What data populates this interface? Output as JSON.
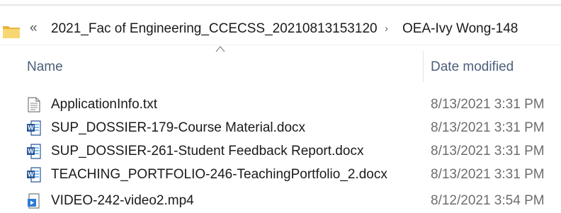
{
  "addressbar": {
    "overflow_label": "«",
    "crumbs": [
      "2021_Fac of Engineering_CCECSS_20210813153120",
      "OEA-Ivy Wong-148"
    ],
    "separator": "›"
  },
  "columns": {
    "name": "Name",
    "date": "Date modified",
    "sort_indicator": "ascending"
  },
  "files": [
    {
      "name": "ApplicationInfo.txt",
      "date": "8/13/2021 3:31 PM",
      "icon": "text-file-icon"
    },
    {
      "name": "SUP_DOSSIER-179-Course Material.docx",
      "date": "8/13/2021 3:31 PM",
      "icon": "word-document-icon"
    },
    {
      "name": "SUP_DOSSIER-261-Student Feedback Report.docx",
      "date": "8/13/2021 3:31 PM",
      "icon": "word-document-icon"
    },
    {
      "name": "TEACHING_PORTFOLIO-246-TeachingPortfolio_2.docx",
      "date": "8/13/2021 3:31 PM",
      "icon": "word-document-icon"
    },
    {
      "name": "VIDEO-242-video2.mp4",
      "date": "8/12/2021 3:54 PM",
      "icon": "video-file-icon"
    }
  ],
  "colors": {
    "header_text": "#4c607a",
    "date_text": "#6d6d6d",
    "folder_yellow": "#f2c94c",
    "word_blue": "#2b579a"
  }
}
